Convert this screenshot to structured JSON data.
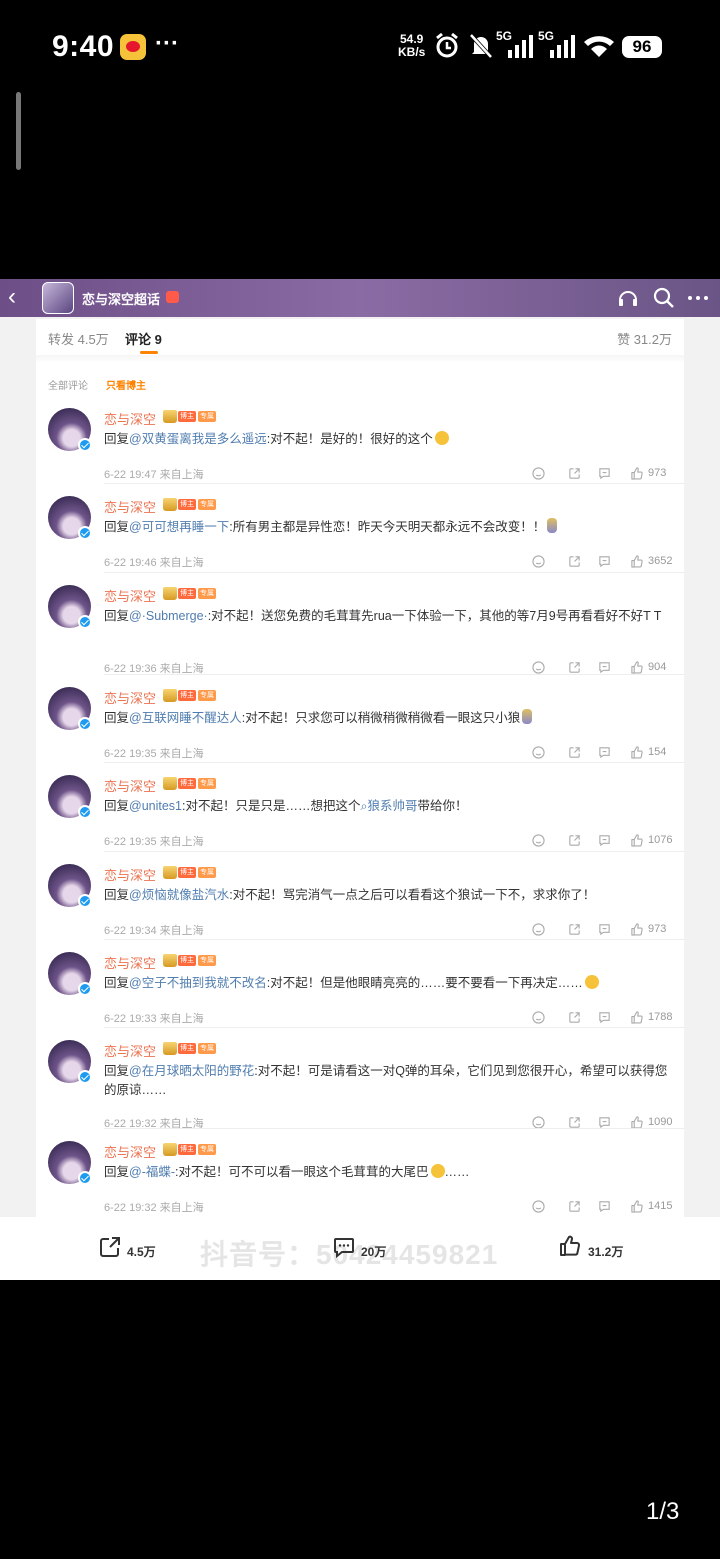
{
  "status_bar": {
    "time": "9:40",
    "net_speed_value": "54.9",
    "net_speed_unit": "KB/s",
    "network_1": "5G",
    "network_2": "5G",
    "battery": "96"
  },
  "topbar": {
    "title": "恋与深空超话"
  },
  "tabs": {
    "repost": "转发 4.5万",
    "comment": "评论 9",
    "likes": "赞 31.2万"
  },
  "filter": {
    "all": "全部评论",
    "author_only": "只看博主"
  },
  "comments": [
    {
      "name": "恋与深空",
      "reply_prefix": "回复",
      "mention": "@双黄蛋离我是多么遥远",
      "text": ":对不起！是好的！很好的这个",
      "date": "6-22 19:47",
      "location": "来自上海",
      "likes": "973"
    },
    {
      "name": "恋与深空",
      "reply_prefix": "回复",
      "mention": "@可可想再睡一下",
      "text": ":所有男主都是异性恋！昨天今天明天都永远不会改变！！",
      "date": "6-22 19:46",
      "location": "来自上海",
      "likes": "3652"
    },
    {
      "name": "恋与深空",
      "reply_prefix": "回复",
      "mention": "@·Submerge·",
      "text": ":对不起！送您免费的毛茸茸先rua一下体验一下，其他的等7月9号再看看好不好T T",
      "date": "6-22 19:36",
      "location": "来自上海",
      "likes": "904"
    },
    {
      "name": "恋与深空",
      "reply_prefix": "回复",
      "mention": "@互联网睡不醒达人",
      "text": ":对不起！只求您可以稍微稍微稍微看一眼这只小狼",
      "date": "6-22 19:35",
      "location": "来自上海",
      "likes": "154"
    },
    {
      "name": "恋与深空",
      "reply_prefix": "回复",
      "mention": "@unites1",
      "text": ":对不起！只是只是……想把这个",
      "link_text": "狼系帅哥",
      "text_after": "带给你！",
      "date": "6-22 19:35",
      "location": "来自上海",
      "likes": "1076"
    },
    {
      "name": "恋与深空",
      "reply_prefix": "回复",
      "mention": "@烦恼就像盐汽水",
      "text": ":对不起！骂完消气一点之后可以看看这个狼试一下不，求求你了！",
      "date": "6-22 19:34",
      "location": "来自上海",
      "likes": "973"
    },
    {
      "name": "恋与深空",
      "reply_prefix": "回复",
      "mention": "@空子不抽到我就不改名",
      "text": ":对不起！但是他眼睛亮亮的……要不要看一下再决定……",
      "date": "6-22 19:33",
      "location": "来自上海",
      "likes": "1788"
    },
    {
      "name": "恋与深空",
      "reply_prefix": "回复",
      "mention": "@在月球晒太阳的野花",
      "text": ":对不起！可是请看这一对Q弹的耳朵，它们见到您很开心，希望可以获得您的原谅……",
      "date": "6-22 19:32",
      "location": "来自上海",
      "likes": "1090"
    },
    {
      "name": "恋与深空",
      "reply_prefix": "回复",
      "mention": "@-福蝶-",
      "text": ":对不起！可不可以看一眼这个毛茸茸的大尾巴",
      "text_after": "……",
      "date": "6-22 19:32",
      "location": "来自上海",
      "likes": "1415"
    }
  ],
  "badges": {
    "b1": "博主",
    "b2": "专属"
  },
  "bottom_bar": {
    "repost": "4.5万",
    "comment": "20万",
    "like": "31.2万",
    "watermark": "抖音号：50424459821"
  },
  "page_indicator": "1/3"
}
